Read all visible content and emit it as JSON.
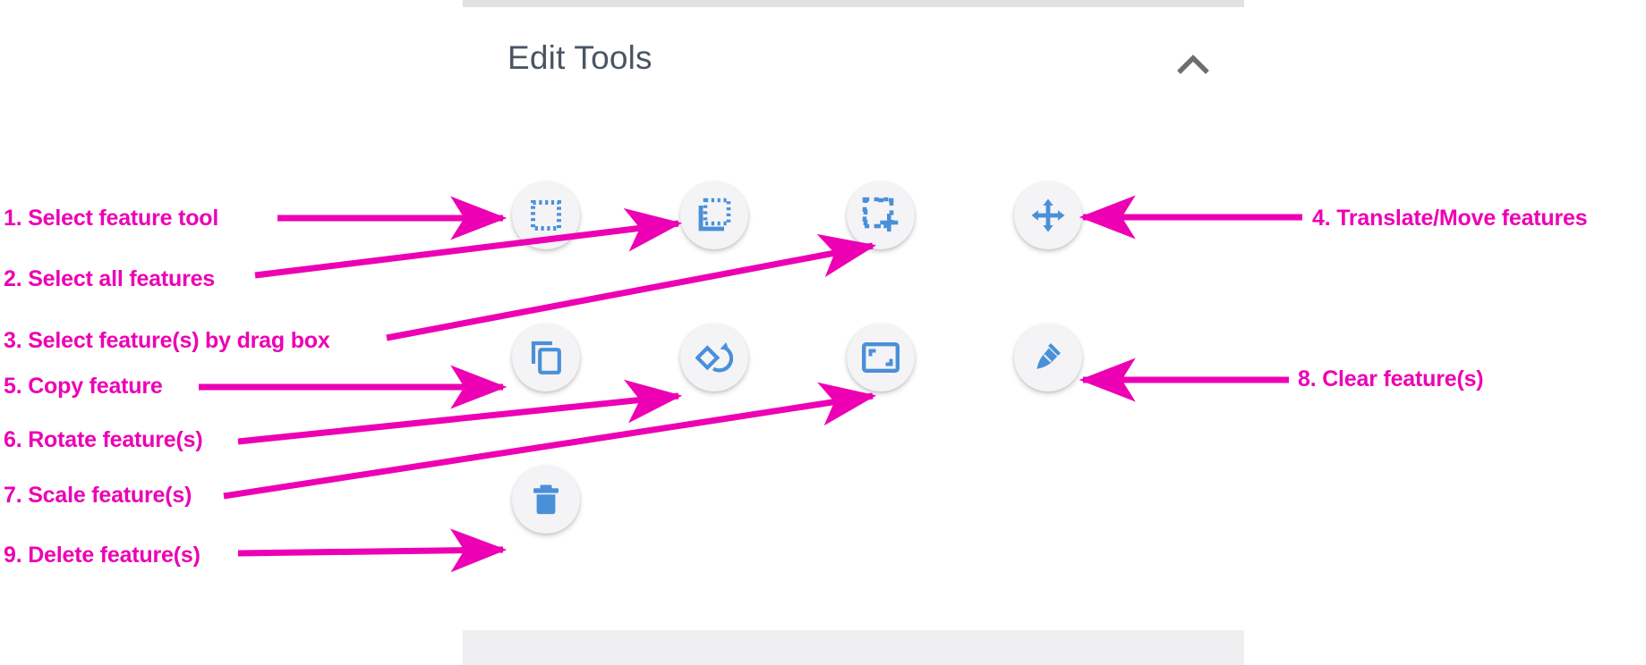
{
  "panel": {
    "title": "Edit Tools",
    "collapse_icon": "chevron-up-icon",
    "accent_blue": "#4a90d9",
    "annotation_color": "#ed00b4",
    "button_bg": "#f4f4f6",
    "title_color": "#4b5563"
  },
  "tools": [
    {
      "n": 1,
      "key": "select-feature",
      "icon": "dashed-square-icon",
      "label": "Select feature tool"
    },
    {
      "n": 2,
      "key": "select-all",
      "icon": "dashed-square-corner-icon",
      "label": "Select all features"
    },
    {
      "n": 3,
      "key": "select-drag-box",
      "icon": "dashed-square-plus-icon",
      "label": "Select feature(s) by drag box"
    },
    {
      "n": 4,
      "key": "translate-move",
      "icon": "move-arrows-icon",
      "label": "Translate/Move features"
    },
    {
      "n": 5,
      "key": "copy-feature",
      "icon": "copy-icon",
      "label": "Copy feature"
    },
    {
      "n": 6,
      "key": "rotate-feature",
      "icon": "rotate-diamond-icon",
      "label": "Rotate feature(s)"
    },
    {
      "n": 7,
      "key": "scale-feature",
      "icon": "scale-corners-icon",
      "label": "Scale feature(s)"
    },
    {
      "n": 8,
      "key": "clear-feature",
      "icon": "broom-icon",
      "label": "Clear feature(s)"
    },
    {
      "n": 9,
      "key": "delete-feature",
      "icon": "trash-icon",
      "label": "Delete feature(s)"
    }
  ],
  "annotations": [
    {
      "id": "a1",
      "text": "1.  Select feature tool"
    },
    {
      "id": "a2",
      "text": "2. Select all features"
    },
    {
      "id": "a3",
      "text": "3. Select feature(s) by drag box"
    },
    {
      "id": "a4",
      "text": "4. Translate/Move features"
    },
    {
      "id": "a5",
      "text": "5. Copy feature"
    },
    {
      "id": "a6",
      "text": "6. Rotate feature(s)"
    },
    {
      "id": "a7",
      "text": "7. Scale feature(s)"
    },
    {
      "id": "a8",
      "text": "8. Clear feature(s)"
    },
    {
      "id": "a9",
      "text": "9. Delete feature(s)"
    }
  ]
}
